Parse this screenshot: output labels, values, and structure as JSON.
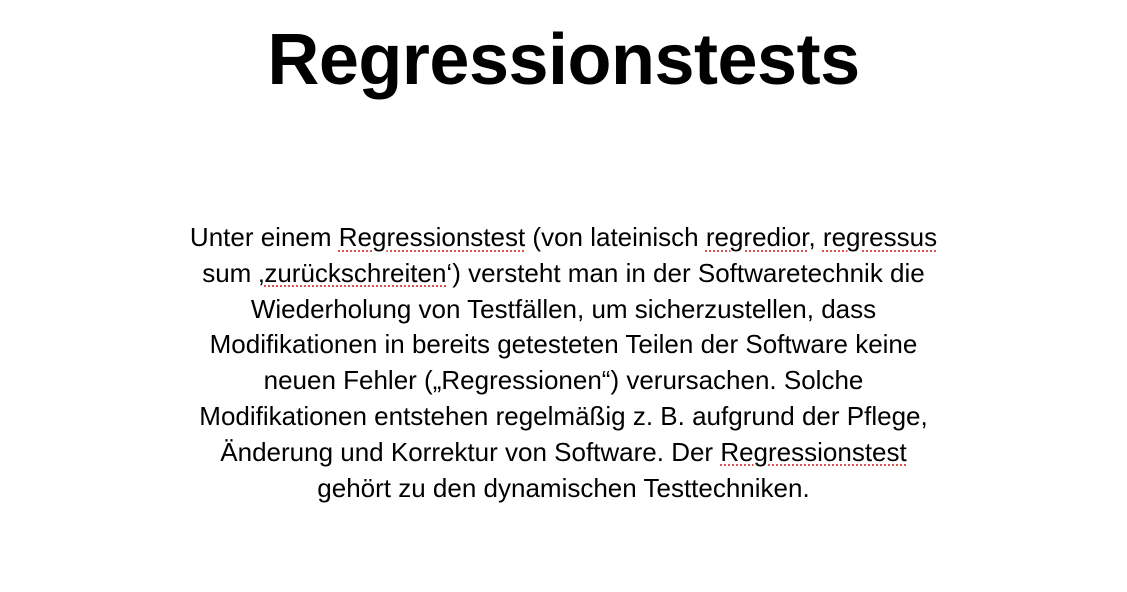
{
  "slide": {
    "title": "Regressionstests",
    "lines": [
      [
        {
          "text": "Unter einem ",
          "spell": false
        },
        {
          "text": "Regressionstest",
          "spell": true
        },
        {
          "text": " (von lateinisch ",
          "spell": false
        },
        {
          "text": "regredior",
          "spell": true
        },
        {
          "text": ", ",
          "spell": false
        },
        {
          "text": "regressus",
          "spell": true
        }
      ],
      [
        {
          "text": "sum ‚",
          "spell": false
        },
        {
          "text": "zurückschreiten",
          "spell": true
        },
        {
          "text": "‘) versteht man in der Softwaretechnik die",
          "spell": false
        }
      ],
      [
        {
          "text": "Wiederholung von Testfällen, um sicherzustellen, dass",
          "spell": false
        }
      ],
      [
        {
          "text": "Modifikationen in bereits getesteten Teilen der Software keine",
          "spell": false
        }
      ],
      [
        {
          "text": "neuen Fehler („Regressionen“) verursachen. Solche",
          "spell": false
        }
      ],
      [
        {
          "text": "Modifikationen entstehen regelmäßig z. B. aufgrund der Pflege,",
          "spell": false
        }
      ],
      [
        {
          "text": "Änderung und Korrektur von Software. Der ",
          "spell": false
        },
        {
          "text": "Regressionstest",
          "spell": true
        }
      ],
      [
        {
          "text": "gehört zu den dynamischen Testtechniken.",
          "spell": false
        }
      ]
    ]
  }
}
